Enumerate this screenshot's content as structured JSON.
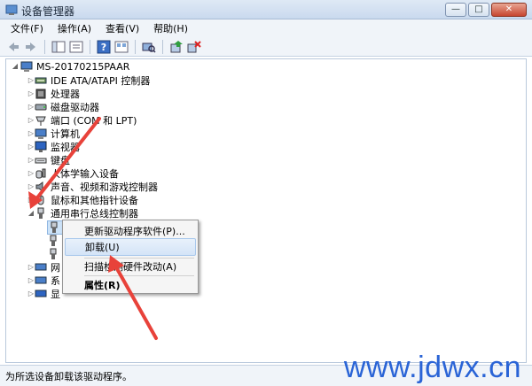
{
  "window": {
    "title": "设备管理器"
  },
  "menu": [
    "文件(F)",
    "操作(A)",
    "查看(V)",
    "帮助(H)"
  ],
  "tree": {
    "root": "MS-20170215PAAR",
    "items": [
      "IDE ATA/ATAPI 控制器",
      "处理器",
      "磁盘驱动器",
      "端口 (COM 和 LPT)",
      "计算机",
      "监视器",
      "键盘",
      "人体学输入设备",
      "声音、视频和游戏控制器",
      "鼠标和其他指针设备",
      "通用串行总线控制器"
    ],
    "partial_items": [
      "网",
      "系",
      "显"
    ]
  },
  "context_menu": {
    "items": [
      "更新驱动程序软件(P)...",
      "卸载(U)",
      "扫描检测硬件改动(A)",
      "属性(R)"
    ]
  },
  "status": "为所选设备卸载该驱动程序。",
  "watermark": "www.jdwx.cn",
  "colors": {
    "accent": "#2a64d6",
    "arrow": "#e8423a"
  }
}
